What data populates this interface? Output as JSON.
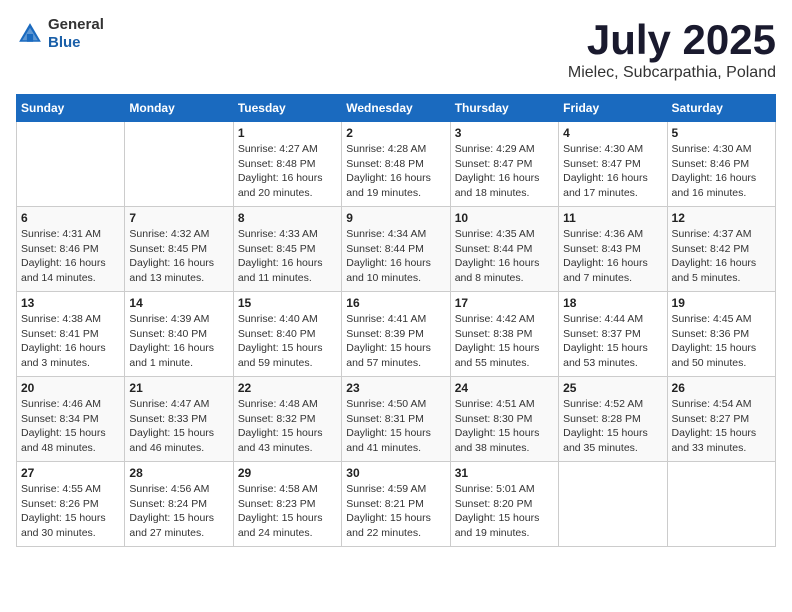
{
  "logo": {
    "general": "General",
    "blue": "Blue"
  },
  "title": "July 2025",
  "subtitle": "Mielec, Subcarpathia, Poland",
  "days_of_week": [
    "Sunday",
    "Monday",
    "Tuesday",
    "Wednesday",
    "Thursday",
    "Friday",
    "Saturday"
  ],
  "weeks": [
    [
      {
        "day": "",
        "info": ""
      },
      {
        "day": "",
        "info": ""
      },
      {
        "day": "1",
        "info": "Sunrise: 4:27 AM\nSunset: 8:48 PM\nDaylight: 16 hours and 20 minutes."
      },
      {
        "day": "2",
        "info": "Sunrise: 4:28 AM\nSunset: 8:48 PM\nDaylight: 16 hours and 19 minutes."
      },
      {
        "day": "3",
        "info": "Sunrise: 4:29 AM\nSunset: 8:47 PM\nDaylight: 16 hours and 18 minutes."
      },
      {
        "day": "4",
        "info": "Sunrise: 4:30 AM\nSunset: 8:47 PM\nDaylight: 16 hours and 17 minutes."
      },
      {
        "day": "5",
        "info": "Sunrise: 4:30 AM\nSunset: 8:46 PM\nDaylight: 16 hours and 16 minutes."
      }
    ],
    [
      {
        "day": "6",
        "info": "Sunrise: 4:31 AM\nSunset: 8:46 PM\nDaylight: 16 hours and 14 minutes."
      },
      {
        "day": "7",
        "info": "Sunrise: 4:32 AM\nSunset: 8:45 PM\nDaylight: 16 hours and 13 minutes."
      },
      {
        "day": "8",
        "info": "Sunrise: 4:33 AM\nSunset: 8:45 PM\nDaylight: 16 hours and 11 minutes."
      },
      {
        "day": "9",
        "info": "Sunrise: 4:34 AM\nSunset: 8:44 PM\nDaylight: 16 hours and 10 minutes."
      },
      {
        "day": "10",
        "info": "Sunrise: 4:35 AM\nSunset: 8:44 PM\nDaylight: 16 hours and 8 minutes."
      },
      {
        "day": "11",
        "info": "Sunrise: 4:36 AM\nSunset: 8:43 PM\nDaylight: 16 hours and 7 minutes."
      },
      {
        "day": "12",
        "info": "Sunrise: 4:37 AM\nSunset: 8:42 PM\nDaylight: 16 hours and 5 minutes."
      }
    ],
    [
      {
        "day": "13",
        "info": "Sunrise: 4:38 AM\nSunset: 8:41 PM\nDaylight: 16 hours and 3 minutes."
      },
      {
        "day": "14",
        "info": "Sunrise: 4:39 AM\nSunset: 8:40 PM\nDaylight: 16 hours and 1 minute."
      },
      {
        "day": "15",
        "info": "Sunrise: 4:40 AM\nSunset: 8:40 PM\nDaylight: 15 hours and 59 minutes."
      },
      {
        "day": "16",
        "info": "Sunrise: 4:41 AM\nSunset: 8:39 PM\nDaylight: 15 hours and 57 minutes."
      },
      {
        "day": "17",
        "info": "Sunrise: 4:42 AM\nSunset: 8:38 PM\nDaylight: 15 hours and 55 minutes."
      },
      {
        "day": "18",
        "info": "Sunrise: 4:44 AM\nSunset: 8:37 PM\nDaylight: 15 hours and 53 minutes."
      },
      {
        "day": "19",
        "info": "Sunrise: 4:45 AM\nSunset: 8:36 PM\nDaylight: 15 hours and 50 minutes."
      }
    ],
    [
      {
        "day": "20",
        "info": "Sunrise: 4:46 AM\nSunset: 8:34 PM\nDaylight: 15 hours and 48 minutes."
      },
      {
        "day": "21",
        "info": "Sunrise: 4:47 AM\nSunset: 8:33 PM\nDaylight: 15 hours and 46 minutes."
      },
      {
        "day": "22",
        "info": "Sunrise: 4:48 AM\nSunset: 8:32 PM\nDaylight: 15 hours and 43 minutes."
      },
      {
        "day": "23",
        "info": "Sunrise: 4:50 AM\nSunset: 8:31 PM\nDaylight: 15 hours and 41 minutes."
      },
      {
        "day": "24",
        "info": "Sunrise: 4:51 AM\nSunset: 8:30 PM\nDaylight: 15 hours and 38 minutes."
      },
      {
        "day": "25",
        "info": "Sunrise: 4:52 AM\nSunset: 8:28 PM\nDaylight: 15 hours and 35 minutes."
      },
      {
        "day": "26",
        "info": "Sunrise: 4:54 AM\nSunset: 8:27 PM\nDaylight: 15 hours and 33 minutes."
      }
    ],
    [
      {
        "day": "27",
        "info": "Sunrise: 4:55 AM\nSunset: 8:26 PM\nDaylight: 15 hours and 30 minutes."
      },
      {
        "day": "28",
        "info": "Sunrise: 4:56 AM\nSunset: 8:24 PM\nDaylight: 15 hours and 27 minutes."
      },
      {
        "day": "29",
        "info": "Sunrise: 4:58 AM\nSunset: 8:23 PM\nDaylight: 15 hours and 24 minutes."
      },
      {
        "day": "30",
        "info": "Sunrise: 4:59 AM\nSunset: 8:21 PM\nDaylight: 15 hours and 22 minutes."
      },
      {
        "day": "31",
        "info": "Sunrise: 5:01 AM\nSunset: 8:20 PM\nDaylight: 15 hours and 19 minutes."
      },
      {
        "day": "",
        "info": ""
      },
      {
        "day": "",
        "info": ""
      }
    ]
  ]
}
